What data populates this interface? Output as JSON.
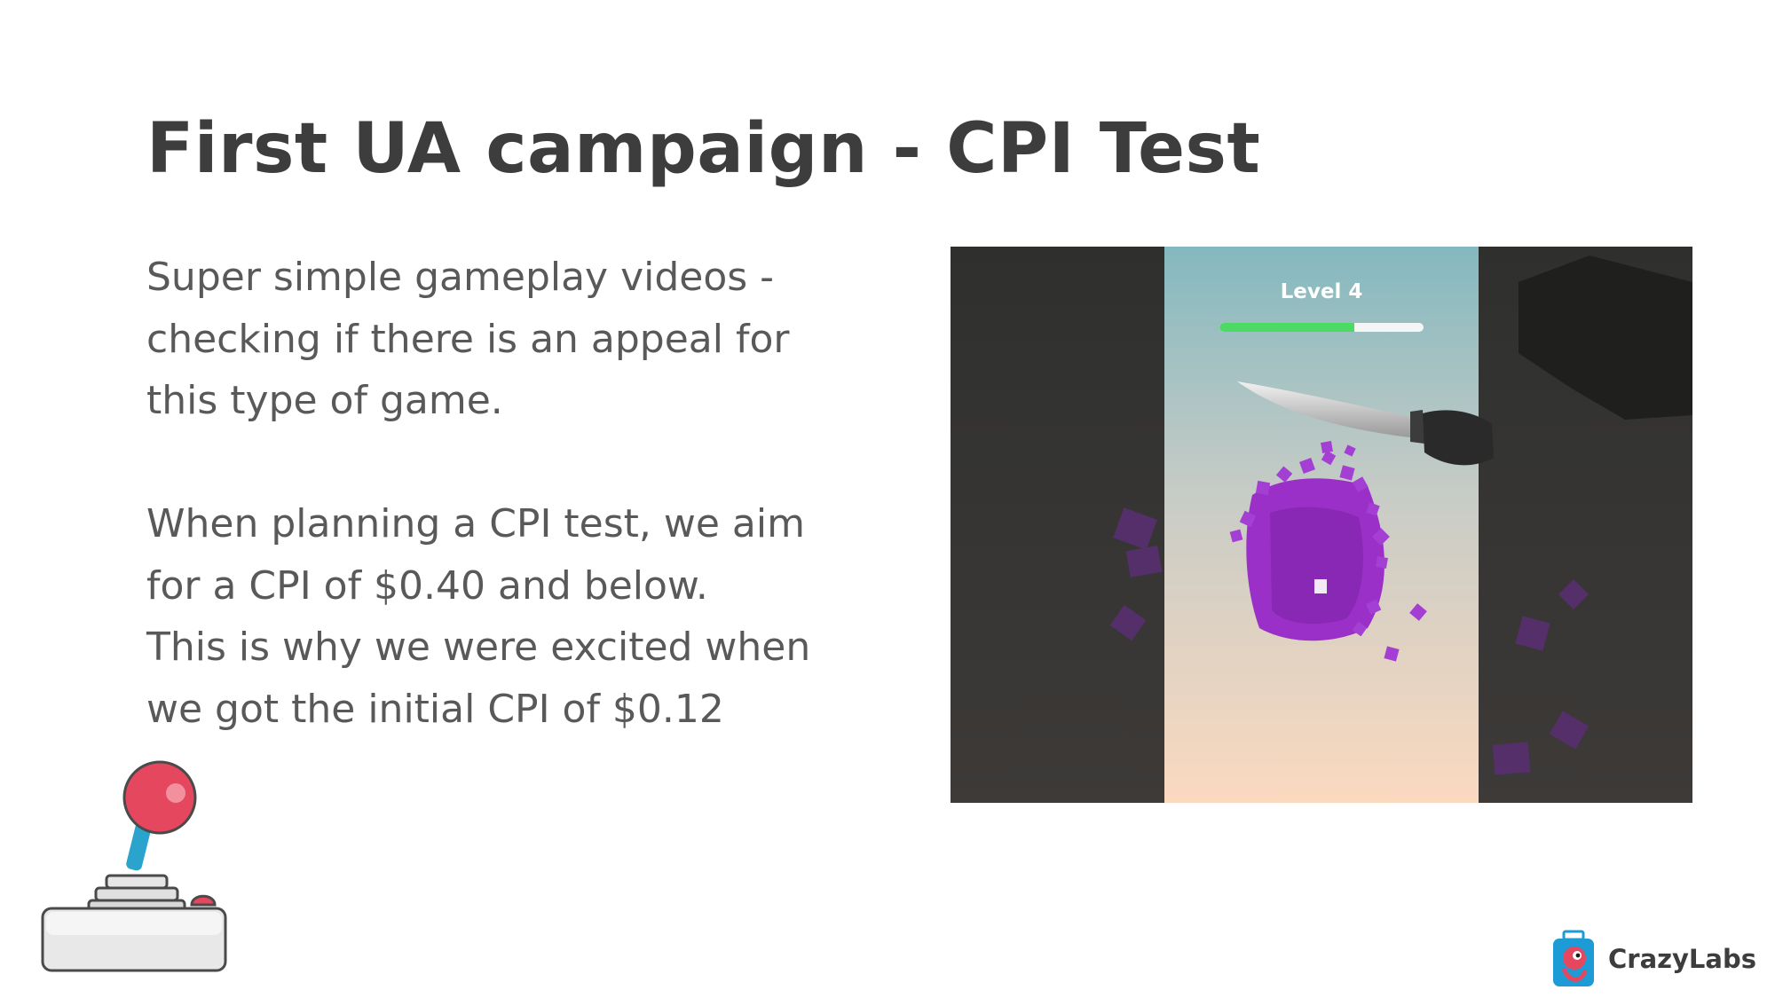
{
  "slide": {
    "title": "First UA campaign - CPI Test",
    "paragraphs": [
      "Super simple gameplay videos  -",
      "checking if there is an appeal for",
      "this type of game.",
      "When planning a CPI test, we aim",
      "for a CPI of $0.40 and below.",
      "This is why we were excited when",
      "we got the initial CPI of $0.12"
    ]
  },
  "video": {
    "level_label": "Level 4",
    "progress_fraction": 0.66
  },
  "logo": {
    "name": "CrazyLabs"
  },
  "colors": {
    "title": "#3d3d3d",
    "body": "#595959",
    "progress": "#4cd964",
    "cube": "#9b30c8",
    "joystick_ball": "#e5475f",
    "joystick_stick": "#2aa4cc"
  },
  "icons": [
    "joystick-icon",
    "crazylabs-logo-icon",
    "knife-icon"
  ]
}
